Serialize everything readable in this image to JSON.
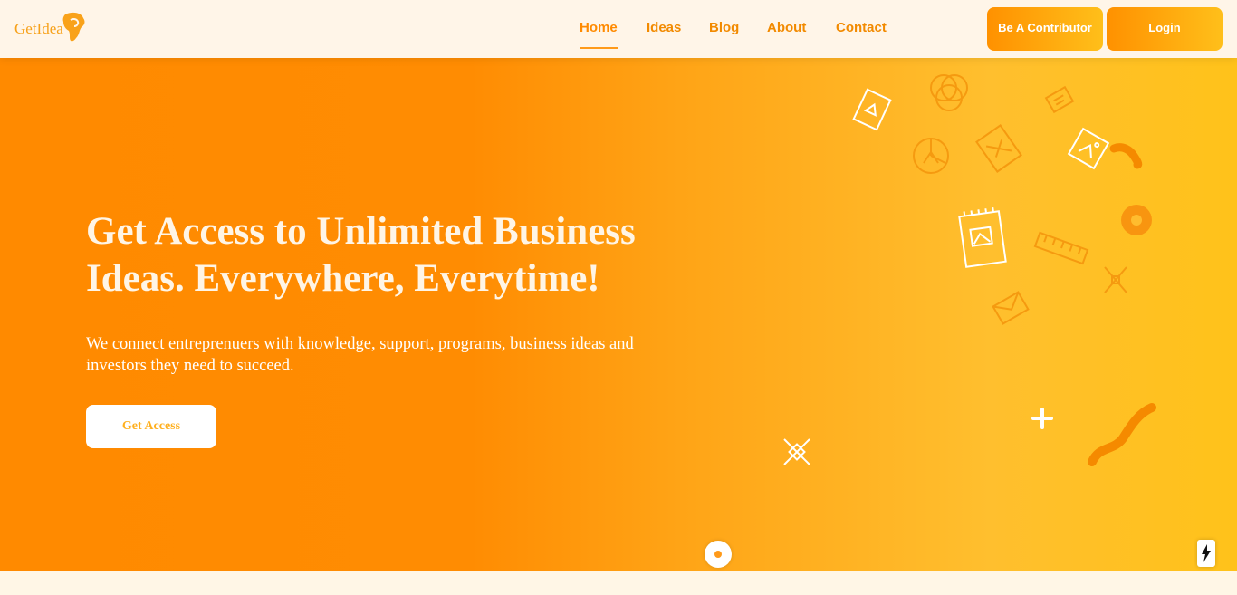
{
  "brand": {
    "name": "GetIdea",
    "logo_icon": "lightbulb-africa-icon"
  },
  "nav": {
    "items": [
      {
        "label": "Home",
        "active": true
      },
      {
        "label": "Ideas",
        "active": false
      },
      {
        "label": "Blog",
        "active": false
      },
      {
        "label": "About",
        "active": false
      },
      {
        "label": "Contact",
        "active": false
      }
    ]
  },
  "header": {
    "contributor_label": "Be A Contributor",
    "login_label": "Login"
  },
  "hero": {
    "title": "Get Access to Unlimited Business Ideas. Everywhere, Everytime!",
    "subtitle": "We connect entreprenuers with knowledge, support, programs, business ideas and investors they need to succeed.",
    "cta_label": "Get Access"
  },
  "colors": {
    "primary": "#ff8a00",
    "accent": "#ffc21a",
    "header_bg": "#fff5e8",
    "text_light": "#fff5e6"
  },
  "icons": [
    "sketchbook-icon",
    "circles-icon",
    "tools-icon",
    "design-board-icon",
    "pie-chart-icon",
    "squiggle-icon",
    "donut-icon",
    "notepad-icon",
    "ruler-icon",
    "pencil-cross-icon",
    "envelope-icon",
    "plus-icon",
    "wave-icon",
    "scroll-indicator-icon",
    "lightning-icon"
  ]
}
